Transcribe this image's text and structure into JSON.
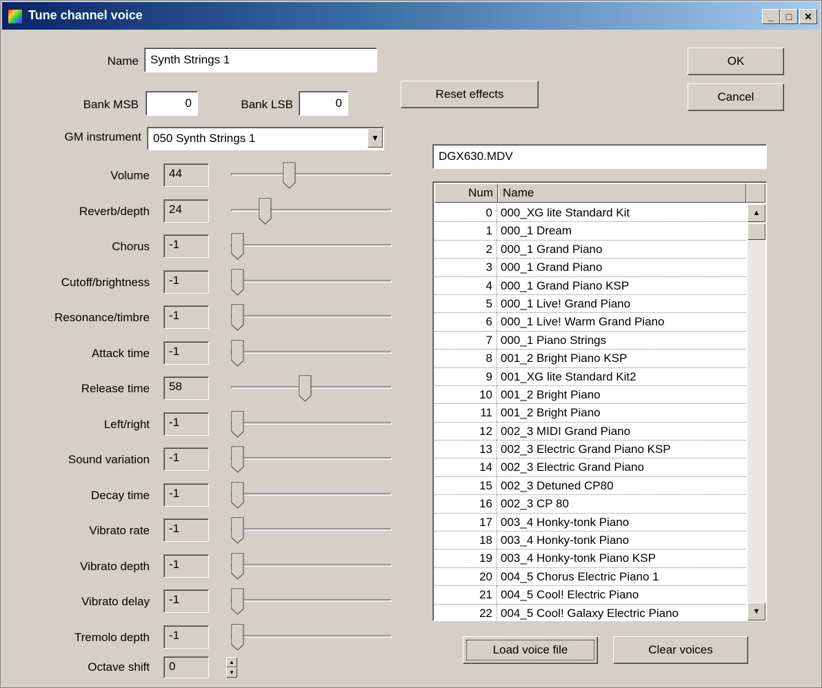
{
  "window": {
    "title": "Tune channel voice",
    "minimize": "_",
    "maximize": "□",
    "close": "✕"
  },
  "form": {
    "name_label": "Name",
    "name_value": "Synth Strings 1",
    "bank_msb_label": "Bank  MSB",
    "bank_msb_value": "0",
    "bank_lsb_label": "Bank LSB",
    "bank_lsb_value": "0",
    "gm_label": "GM instrument",
    "gm_value": "050 Synth Strings 1"
  },
  "buttons": {
    "reset": "Reset effects",
    "ok": "OK",
    "cancel": "Cancel",
    "load": "Load voice file",
    "clear": "Clear voices"
  },
  "file_field": "DGX630.MDV",
  "sliders": [
    {
      "label": "Volume",
      "value": "44",
      "level": 0.35
    },
    {
      "label": "Reverb/depth",
      "value": "24",
      "level": 0.19
    },
    {
      "label": "Chorus",
      "value": "-1",
      "level": 0
    },
    {
      "label": "Cutoff/brightness",
      "value": "-1",
      "level": 0
    },
    {
      "label": "Resonance/timbre",
      "value": "-1",
      "level": 0
    },
    {
      "label": "Attack time",
      "value": "-1",
      "level": 0
    },
    {
      "label": "Release time",
      "value": "58",
      "level": 0.46
    },
    {
      "label": "Left/right",
      "value": "-1",
      "level": 0
    },
    {
      "label": "Sound variation",
      "value": "-1",
      "level": 0
    },
    {
      "label": "Decay time",
      "value": "-1",
      "level": 0
    },
    {
      "label": "Vibrato rate",
      "value": "-1",
      "level": 0
    },
    {
      "label": "Vibrato depth",
      "value": "-1",
      "level": 0
    },
    {
      "label": "Vibrato delay",
      "value": "-1",
      "level": 0
    },
    {
      "label": "Tremolo depth",
      "value": "-1",
      "level": 0
    }
  ],
  "octave": {
    "label": "Octave shift",
    "value": "0"
  },
  "list": {
    "col_num": "Num",
    "col_name": "Name",
    "rows": [
      [
        "0",
        "000_XG lite Standard Kit"
      ],
      [
        "1",
        "000_1 Dream"
      ],
      [
        "2",
        "000_1 Grand Piano"
      ],
      [
        "3",
        "000_1 Grand Piano"
      ],
      [
        "4",
        "000_1 Grand Piano KSP"
      ],
      [
        "5",
        "000_1 Live! Grand Piano"
      ],
      [
        "6",
        "000_1 Live! Warm Grand Piano"
      ],
      [
        "7",
        "000_1 Piano Strings"
      ],
      [
        "8",
        "001_2 Bright Piano KSP"
      ],
      [
        "9",
        "001_XG lite Standard Kit2"
      ],
      [
        "10",
        "001_2 Bright Piano"
      ],
      [
        "11",
        "001_2 Bright Piano"
      ],
      [
        "12",
        "002_3 MIDI Grand Piano"
      ],
      [
        "13",
        "002_3 Electric Grand Piano KSP"
      ],
      [
        "14",
        "002_3 Electric Grand Piano"
      ],
      [
        "15",
        "002_3 Detuned CP80"
      ],
      [
        "16",
        "002_3 CP 80"
      ],
      [
        "17",
        "003_4 Honky-tonk Piano"
      ],
      [
        "18",
        "003_4 Honky-tonk Piano"
      ],
      [
        "19",
        "003_4 Honky-tonk Piano KSP"
      ],
      [
        "20",
        "004_5 Chorus Electric Piano 1"
      ],
      [
        "21",
        "004_5 Cool! Electric Piano"
      ],
      [
        "22",
        "004_5 Cool! Galaxy Electric Piano"
      ]
    ]
  }
}
